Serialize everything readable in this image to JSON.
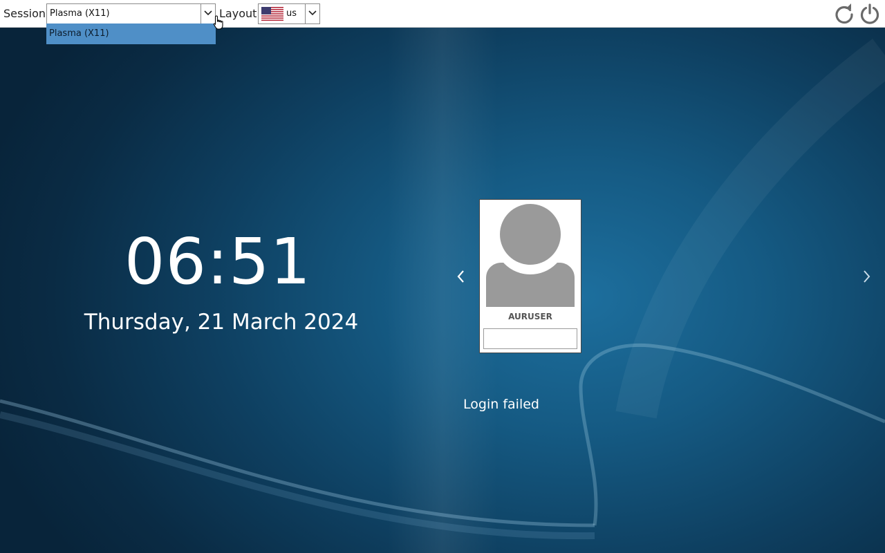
{
  "topbar": {
    "session_label": "Session",
    "session_value": "Plasma (X11)",
    "session_options": [
      "Plasma (X11)"
    ],
    "layout_label": "Layout",
    "layout_value": "us",
    "layout_flag": "us-flag-icon"
  },
  "clock": {
    "time": "06:51",
    "date": "Thursday, 21 March 2024"
  },
  "user": {
    "name": "AURUSER",
    "password_value": ""
  },
  "status": {
    "message": "Login failed"
  },
  "colors": {
    "accent": "#4f8fc7",
    "background": "#155a83"
  }
}
